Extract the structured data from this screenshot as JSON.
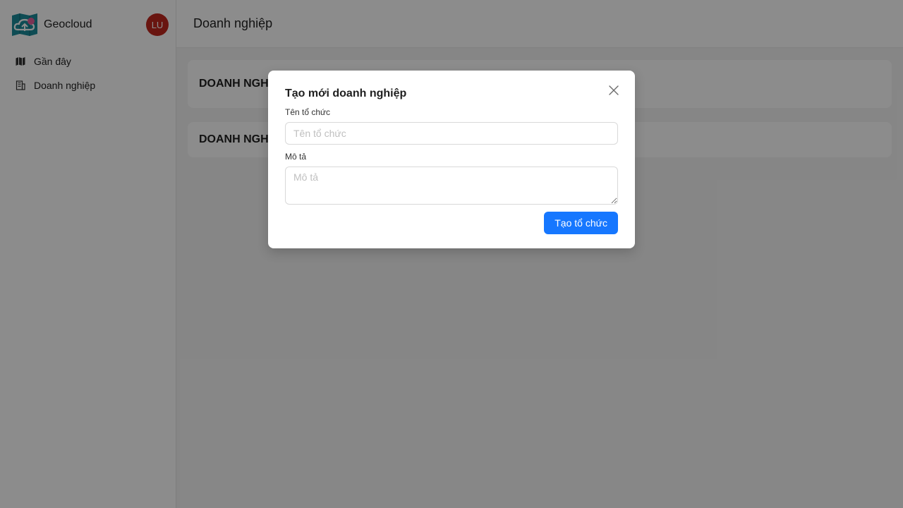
{
  "sidebar": {
    "brand_name": "Geocloud",
    "brand_icon": "cloud-map-logo",
    "avatar_initials": "LU",
    "items": [
      {
        "label": "Gần đây",
        "icon": "map-icon"
      },
      {
        "label": "Doanh nghiệp",
        "icon": "building-icon"
      }
    ]
  },
  "header": {
    "title": "Doanh nghiệp"
  },
  "cards": [
    {
      "title": "DOANH NGHI"
    },
    {
      "title": "DOANH NGHI"
    }
  ],
  "modal": {
    "title": "Tạo mới doanh nghiệp",
    "name_label": "Tên tổ chức",
    "name_placeholder": "Tên tổ chức",
    "name_value": "",
    "desc_label": "Mô tả",
    "desc_placeholder": "Mô tả",
    "desc_value": "",
    "submit_label": "Tạo tổ chức"
  },
  "colors": {
    "primary": "#1677ff",
    "avatar": "#c0271e",
    "logo_teal": "#1a8a99",
    "logo_pink": "#e0609a"
  }
}
